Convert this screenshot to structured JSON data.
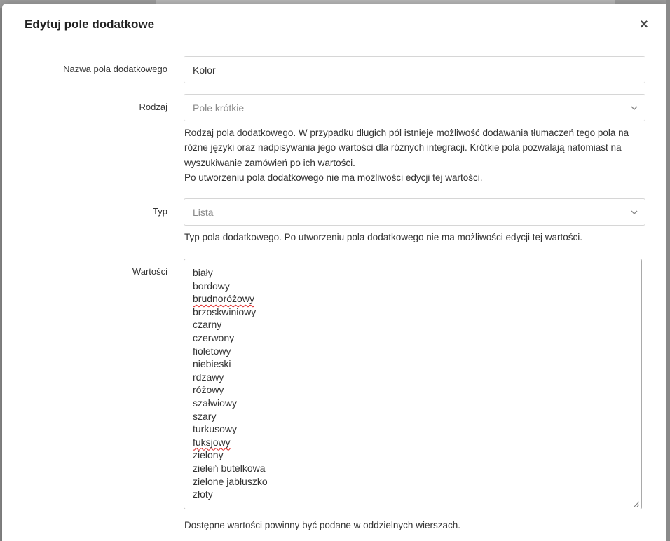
{
  "modal": {
    "title": "Edytuj pole dodatkowe",
    "close_label": "×"
  },
  "form": {
    "name": {
      "label": "Nazwa pola dodatkowego",
      "value": "Kolor"
    },
    "kind": {
      "label": "Rodzaj",
      "selected": "Pole krótkie",
      "help": [
        "Rodzaj pola dodatkowego. W przypadku długich pól istnieje możliwość dodawania tłumaczeń tego pola na różne języki oraz nadpisywania jego wartości dla różnych integracji. Krótkie pola pozwalają natomiast na wyszukiwanie zamówień po ich wartości.",
        "Po utworzeniu pola dodatkowego nie ma możliwości edycji tej wartości."
      ]
    },
    "type": {
      "label": "Typ",
      "selected": "Lista",
      "help": "Typ pola dodatkowego. Po utworzeniu pola dodatkowego nie ma możliwości edycji tej wartości."
    },
    "values": {
      "label": "Wartości",
      "items": [
        "biały",
        "bordowy",
        "brudnoróżowy",
        "brzoskwiniowy",
        "czarny",
        "czerwony",
        "fioletowy",
        "niebieski",
        "rdzawy",
        "różowy",
        "szałwiowy",
        "szary",
        "turkusowy",
        "fuksjowy",
        "zielony",
        "zieleń butelkowa",
        "zielone jabłuszko",
        "złoty"
      ],
      "help": "Dostępne wartości powinny być podane w oddzielnych wierszach."
    }
  },
  "icons": {
    "close": "close-icon",
    "select_chevron": "chevron-down-icon",
    "resize": "resize-handle-icon"
  },
  "colors": {
    "text": "#333333",
    "border": "#d6d6d6",
    "placeholder": "#8a8a8a",
    "spellcheck": "#dd2222"
  }
}
